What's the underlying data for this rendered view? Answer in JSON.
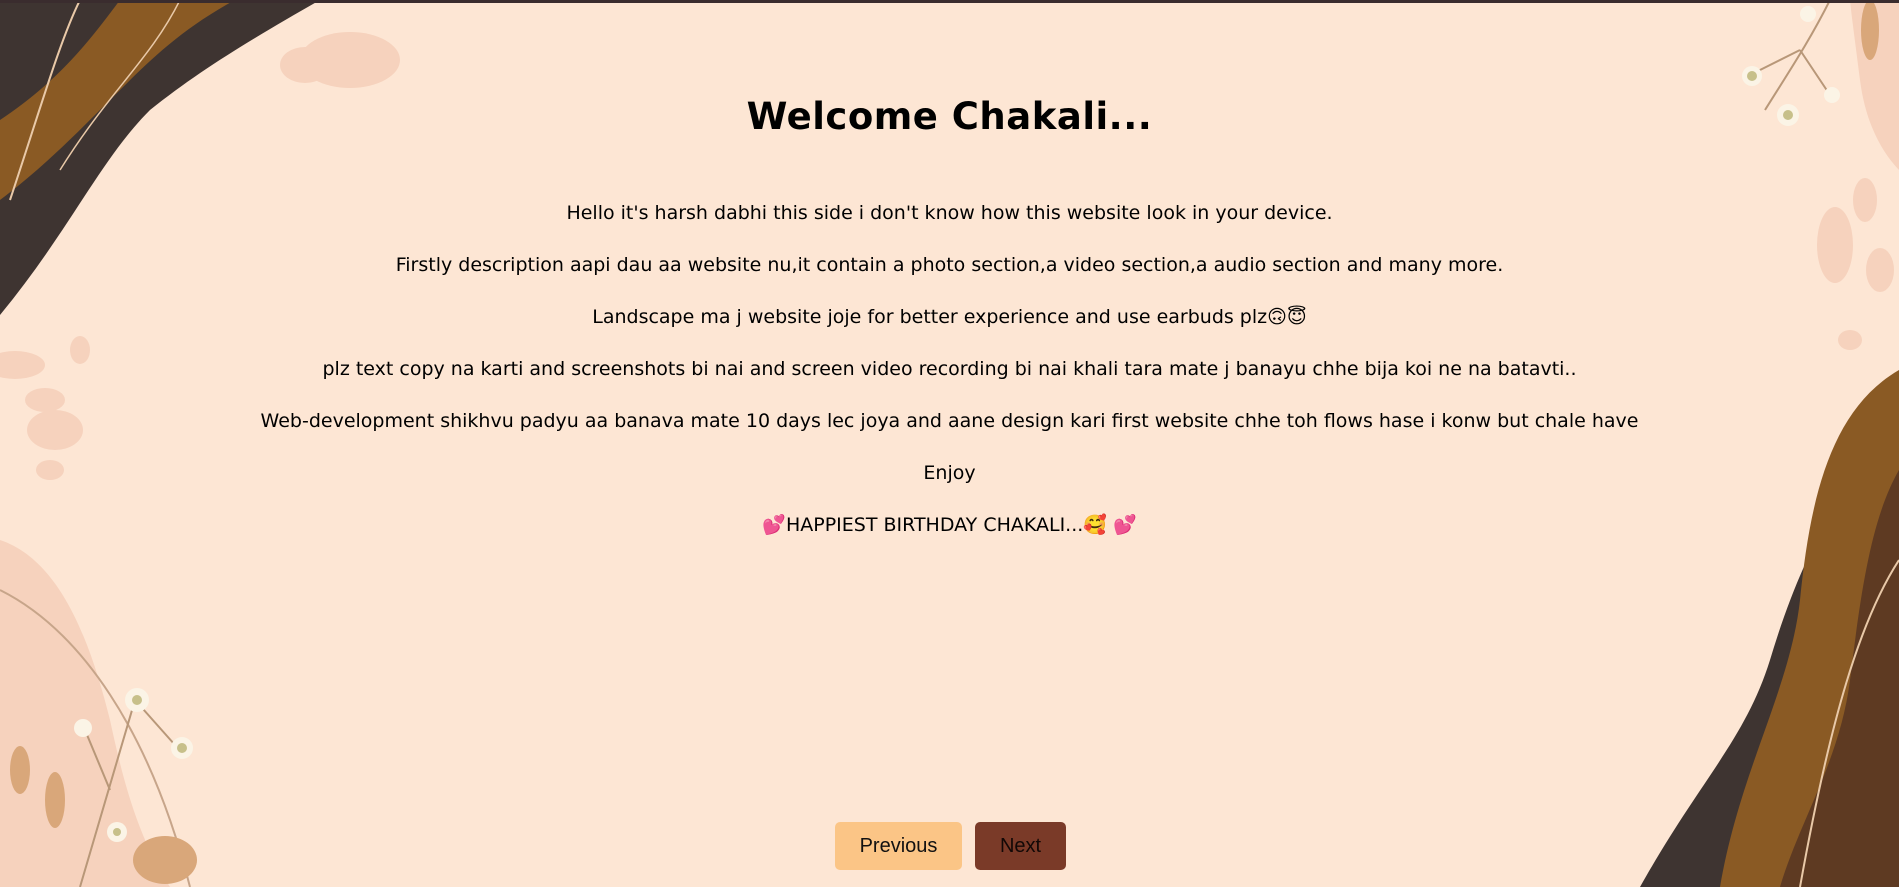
{
  "page": {
    "title": "Welcome Chakali...",
    "paragraphs": [
      "Hello it's harsh dabhi this side i don't know how this website look in your device.",
      "Firstly description aapi dau aa website nu,it contain a photo section,a video section,a audio section and many more.",
      "Landscape ma j website joje for better experience and use earbuds plz🙃😇",
      "plz text copy na karti and screenshots bi nai and screen video recording bi nai khali tara mate j banayu chhe bija koi ne na batavti..",
      "Web-development shikhvu padyu aa banava mate 10 days lec joya and aane design kari first website chhe toh flows hase i konw but chale have",
      "Enjoy"
    ],
    "birthday": {
      "emoji_left": "💕",
      "text": "HAPPIEST BIRTHDAY CHAKALI...",
      "emoji_middle": "🥰",
      "emoji_right": "💕"
    }
  },
  "nav": {
    "previous_label": "Previous",
    "next_label": "Next"
  },
  "colors": {
    "background": "#fde6d4",
    "previous_button": "#fbc586",
    "next_button": "#7a3a28",
    "decor_dark": "#3e3431",
    "decor_brown": "#8a5a24",
    "decor_dark_brown": "#5e3a22",
    "decor_light": "#f6d2bd"
  }
}
